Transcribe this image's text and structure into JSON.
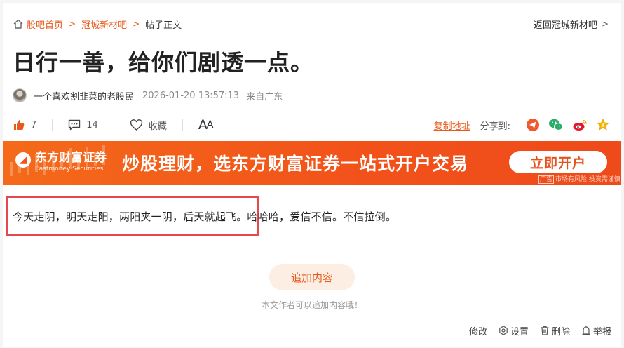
{
  "breadcrumb": {
    "items": [
      "股吧首页",
      "冠城新材吧",
      "帖子正文"
    ],
    "back_label": "返回冠城新材吧"
  },
  "post": {
    "title": "日行一善，给你们剧透一点。",
    "author": "一个喜欢割韭菜的老股民",
    "time": "2026-01-20 13:57:13",
    "location": "来自广东",
    "content": "今天走阴，明天走阳，两阳夹一阴，后天就起飞。哈哈哈，爱信不信。不信拉倒。"
  },
  "actions": {
    "like_count": "7",
    "comment_count": "14",
    "favorite_label": "收藏",
    "font_size_label_big": "A",
    "font_size_label_small": "A",
    "copy_link": "复制地址",
    "share_label": "分享到:"
  },
  "banner": {
    "brand": "东方财富证券",
    "brand_en": "Eastmoney Securities",
    "slogan": "炒股理财，选东方财富证券一站式开户交易",
    "cta": "立即开户",
    "ad_badge": "广告",
    "ad_note": "市场有风险 投资需谨慎"
  },
  "add_content": {
    "button": "追加内容",
    "tip": "本文作者可以追加内容哦！"
  },
  "footer": {
    "edit": "修改",
    "settings": "设置",
    "delete": "删除",
    "report": "举报"
  },
  "colors": {
    "accent": "#e85a1c",
    "highlight_border": "#e5484d",
    "banner": "#f2531a"
  }
}
